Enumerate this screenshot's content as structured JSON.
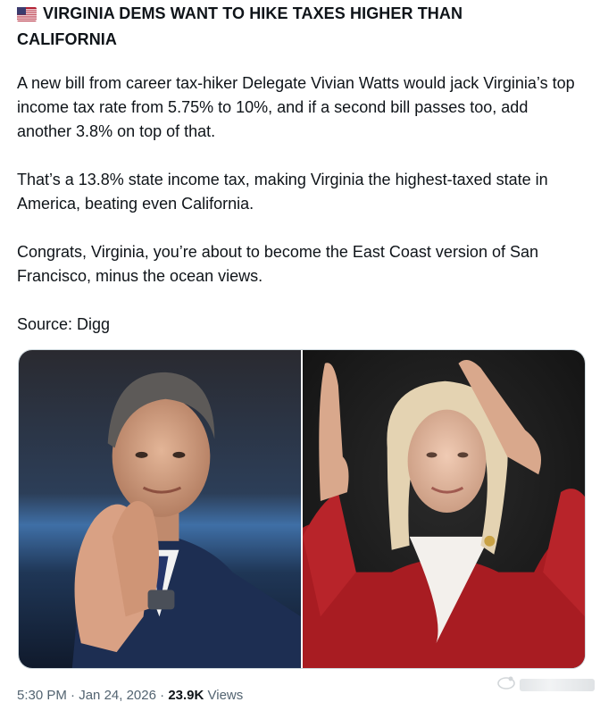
{
  "post": {
    "title": "VIRGINIA DEMS WANT TO HIKE TAXES HIGHER THAN CALIFORNIA",
    "paragraphs": [
      "A new bill from career tax-hiker Delegate Vivian Watts would jack Virginia’s top income tax rate from 5.75% to 10%, and if a second bill passes too, add another 3.8% on top of that.",
      "That’s a 13.8% state income tax, making Virginia the highest-taxed state in America, beating even California.",
      "Congrats, Virginia, you’re about to become the East Coast version of San Francisco, minus the ocean views.",
      "Source: Digg"
    ],
    "flag_icon": "us-flag-icon"
  },
  "meta": {
    "time": "5:30 PM",
    "separator": " · ",
    "date": "Jan 24, 2026",
    "views_count": "23.9K",
    "views_label": " Views"
  },
  "colors": {
    "text": "#0f1419",
    "secondary": "#536471",
    "border": "#cfd9de",
    "left_photo_bg": "#1b2b44",
    "right_photo_bg": "#151515",
    "suit_red": "#a81c22"
  }
}
